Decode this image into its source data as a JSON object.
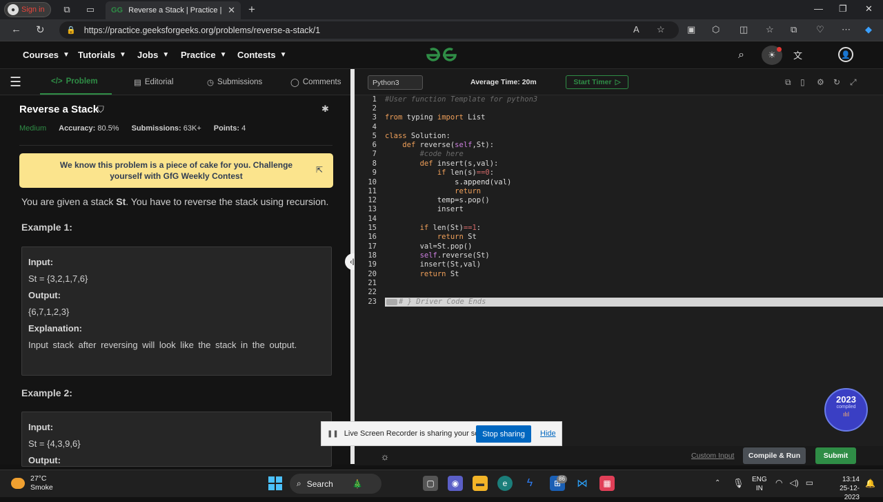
{
  "browser": {
    "profile_label": "Sign in",
    "tab_title": "Reverse a Stack | Practice | GeeksforGeeks",
    "url": "https://practice.geeksforgeeks.org/problems/reverse-a-stack/1"
  },
  "header": {
    "menu": [
      "Courses",
      "Tutorials",
      "Jobs",
      "Practice",
      "Contests"
    ]
  },
  "left_tabs": [
    {
      "label": "Problem",
      "icon": "code-icon"
    },
    {
      "label": "Editorial",
      "icon": "document-icon"
    },
    {
      "label": "Submissions",
      "icon": "clock-icon"
    },
    {
      "label": "Comments",
      "icon": "comment-icon"
    }
  ],
  "problem": {
    "title": "Reverse a Stack",
    "difficulty": "Medium",
    "accuracy_label": "Accuracy:",
    "accuracy": "80.5%",
    "submissions_label": "Submissions:",
    "submissions": "63K+",
    "points_label": "Points:",
    "points": "4",
    "banner": "We know this problem is a piece of cake for you. Challenge yourself with GfG Weekly Contest",
    "desc_prefix": "You are given a stack ",
    "desc_var": "St",
    "desc_suffix": ". You have to reverse the stack using recursion.",
    "examples": [
      {
        "heading": "Example 1:",
        "input_label": "Input:",
        "input": "St = {3,2,1,7,6}",
        "output_label": "Output:",
        "output": "{6,7,1,2,3}",
        "explanation_label": "Explanation:",
        "explanation": "Input stack after reversing will look like the stack in the output."
      },
      {
        "heading": "Example 2:",
        "input_label": "Input:",
        "input": "St = {4,3,9,6}",
        "output_label": "Output:"
      }
    ]
  },
  "editor": {
    "language": "Python3",
    "average_time": "Average Time: 20m",
    "timer_label": "Start Timer",
    "line_numbers": [
      "1",
      "2",
      "3",
      "4",
      "5",
      "6",
      "7",
      "8",
      "9",
      "10",
      "11",
      "12",
      "13",
      "14",
      "15",
      "16",
      "17",
      "18",
      "19",
      "20",
      "21",
      "22",
      "23"
    ],
    "driver_line": "# } Driver Code Ends"
  },
  "actions": {
    "custom_input": "Custom Input",
    "compile_run": "Compile & Run",
    "submit": "Submit"
  },
  "share_bar": {
    "message": "Live Screen Recorder is sharing your screen.",
    "stop": "Stop sharing",
    "hide": "Hide"
  },
  "badge": {
    "year": "2023",
    "caption": "compiled"
  },
  "taskbar": {
    "temperature": "27°C",
    "weather": "Smoke",
    "search": "Search",
    "store_badge": "86",
    "lang_top": "ENG",
    "lang_bottom": "IN",
    "time": "13:14",
    "date": "25-12-2023"
  }
}
